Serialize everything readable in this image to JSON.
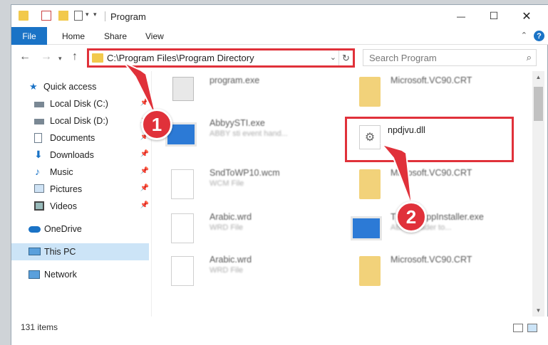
{
  "window": {
    "title": "Program",
    "minimize": "—",
    "maximize": "☐",
    "close": "✕"
  },
  "ribbon": {
    "tabs": [
      "File",
      "Home",
      "Share",
      "View"
    ],
    "help": "?"
  },
  "address": {
    "path": "C:\\Program Files\\Program Directory",
    "refresh": "↻"
  },
  "search": {
    "placeholder": "Search Program"
  },
  "nav": {
    "items": [
      {
        "label": "Quick access",
        "icon": "star-icon"
      },
      {
        "label": "Local Disk (C:)",
        "icon": "drive-icon"
      },
      {
        "label": "Local Disk (D:)",
        "icon": "drive-icon"
      },
      {
        "label": "Documents",
        "icon": "documents-icon"
      },
      {
        "label": "Downloads",
        "icon": "download-icon"
      },
      {
        "label": "Music",
        "icon": "music-icon"
      },
      {
        "label": "Pictures",
        "icon": "pictures-icon"
      },
      {
        "label": "Videos",
        "icon": "videos-icon"
      },
      {
        "label": "OneDrive",
        "icon": "cloud-icon"
      },
      {
        "label": "This PC",
        "icon": "computer-icon"
      },
      {
        "label": "Network",
        "icon": "network-icon"
      }
    ]
  },
  "files": [
    {
      "name": "program.exe",
      "sub": ""
    },
    {
      "name": "Microsoft.VC90.CRT",
      "sub": ""
    },
    {
      "name": "AbbyySTI.exe",
      "sub": "ABBY sti event hand..."
    },
    {
      "name": "npdjvu.dll",
      "sub": ""
    },
    {
      "name": "SndToWP10.wcm",
      "sub": "WCM File"
    },
    {
      "name": "Microsoft.VC90.CRT",
      "sub": ""
    },
    {
      "name": "Arabic.wrd",
      "sub": "WRD File"
    },
    {
      "name": "TrackerAppInstaller.exe",
      "sub": "ABBY reader to..."
    },
    {
      "name": "Arabic.wrd",
      "sub": "WRD File"
    },
    {
      "name": "Microsoft.VC90.CRT",
      "sub": ""
    }
  ],
  "status": {
    "count": "131 items"
  },
  "annotations": {
    "step1": "1",
    "step2": "2"
  },
  "colors": {
    "accent": "#1a73c6",
    "highlight": "#e0313a",
    "selection": "#cce4f7"
  }
}
